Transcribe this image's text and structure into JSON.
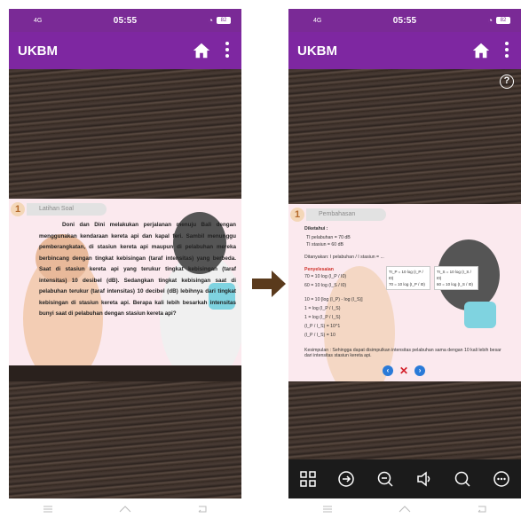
{
  "status_bar": {
    "time": "05:55",
    "network": "4G",
    "battery": "82"
  },
  "app": {
    "title": "UKBM"
  },
  "left_slide": {
    "number": "1",
    "tab_label": "Latihan Soal",
    "question": "Doni dan Dini melakukan perjalanan menuju Bali dengan menggunakan kendaraan kereta api dan kapal feri. Sambil menunggu pemberangkatan, di stasiun kereta api maupun di pelabuhan mereka berbincang dengan tingkat kebisingan (taraf intensitas) yang berbeda. Saat di stasiun kereta api yang terukur tingkat kebisingan (taraf intensitas) 10 desibel (dB). Sedangkan tingkat kebisingan saat di pelabuhan terukur (taraf intensitas) 10 decibel (dB) lebihnya dari tingkat kebisingan di stasiun kereta api. Berapa kali lebih besarkah intensitas bunyi saat di pelabuhan dengan stasiun kereta api?"
  },
  "right_slide": {
    "number": "1",
    "tab_label": "Pembahasan",
    "diketahui_label": "Diketahui :",
    "given_1": "TI pelabuhan = 70 dB",
    "given_2": "TI stasiun = 60 dB",
    "ditanyakan": "Ditanyakan: I pelabuhan / I stasiun = ...",
    "penyelesaian_label": "Penyelesaian",
    "step_1": "70 = 10 log (I_P / I0)",
    "step_2": "60 = 10 log (I_S / I0)",
    "step_3": "10 = 10 [log (I_P) - log (I_S)]",
    "step_4": "1 = log (I_P / I_S)",
    "step_5": "1 = log (I_P / I_S)",
    "step_6": "(I_P / I_S) = 10^1",
    "step_7": "(I_P / I_S) = 10",
    "box_1a": "TI_P = 10 log (I_P / I0)",
    "box_1b": "70 = 10 log (I_P / I0)",
    "box_2a": "TI_S = 10 log (I_S / I0)",
    "box_2b": "60 = 10 log (I_S / I0)",
    "conclusion": "Kesimpulan : Sehingga dapat disimpulkan intensitas pelabuhan sama dengan 10 kali lebih besar dari intensitas stasiun kereta api."
  },
  "icons": {
    "home": "home-icon",
    "more": "more-vert-icon",
    "help": "help-icon",
    "prev": "prev-icon",
    "close": "close-icon",
    "next": "next-icon",
    "grid": "grid-icon",
    "goto": "goto-icon",
    "zoom_out": "zoom-out-icon",
    "sound": "sound-icon",
    "search": "search-icon",
    "more_h": "more-horiz-icon"
  },
  "colors": {
    "app_bar": "#7e27a1",
    "status_bar": "#7a2a96",
    "slide_bg": "#fbe9ee",
    "nav_blue": "#2a7ad8",
    "close_red": "#d4202a",
    "arrow_brown": "#5a3a1c"
  }
}
